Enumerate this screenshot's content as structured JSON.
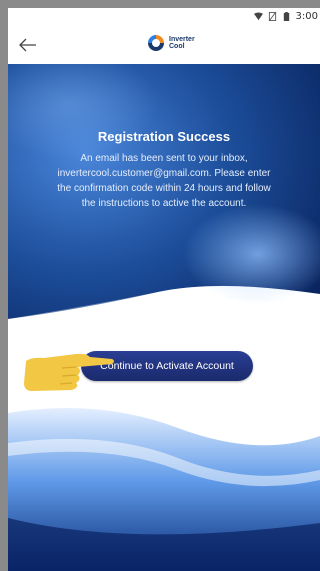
{
  "status_bar": {
    "time": "3:00",
    "icons": [
      "wifi-icon",
      "sim-icon",
      "battery-icon"
    ]
  },
  "header": {
    "back_icon": "arrow-left-icon",
    "logo_line1": "Inverter",
    "logo_line2": "Cool"
  },
  "hero": {
    "title": "Registration Success",
    "message": "An email has been sent to your inbox, invertercool.customer@gmail.com. Please enter the confirmation code within 24 hours and follow the instructions to active the account."
  },
  "actions": {
    "continue_label": "Continue to Activate Account"
  },
  "colors": {
    "primary": "#1f3180",
    "hero_dark": "#0b2a6e",
    "hand": "#f2c744"
  }
}
